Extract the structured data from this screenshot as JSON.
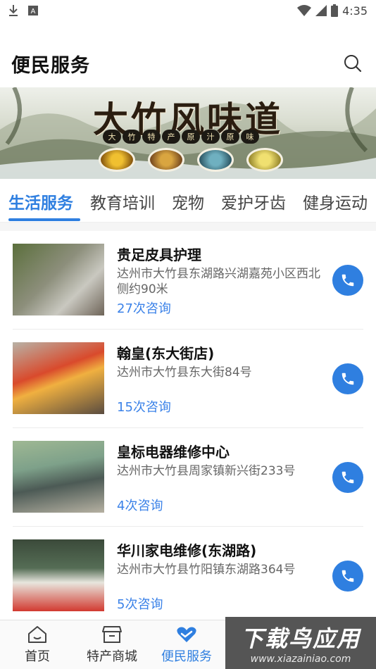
{
  "status": {
    "time": "4:35"
  },
  "header": {
    "title": "便民服务"
  },
  "banner": {
    "title": "大竹风味道",
    "tags": [
      "大",
      "竹",
      "特",
      "产",
      "原",
      "汁",
      "原",
      "味"
    ]
  },
  "tabs": [
    {
      "label": "生活服务",
      "active": true
    },
    {
      "label": "教育培训"
    },
    {
      "label": "宠物"
    },
    {
      "label": "爱护牙齿"
    },
    {
      "label": "健身运动"
    }
  ],
  "listings": [
    {
      "name": "贵足皮具护理",
      "address": "达州市大竹县东湖路兴湖嘉苑小区西北侧约90米",
      "consult": "27次咨询"
    },
    {
      "name": "翰皇(东大街店)",
      "address": "达州市大竹县东大街84号",
      "consult": "15次咨询"
    },
    {
      "name": "皇标电器维修中心",
      "address": "达州市大竹县周家镇新兴街233号",
      "consult": "4次咨询"
    },
    {
      "name": "华川家电维修(东湖路)",
      "address": "达州市大竹县竹阳镇东湖路364号",
      "consult": "5次咨询"
    }
  ],
  "nav": {
    "home": "首页",
    "mall": "特产商城",
    "service": "便民服务"
  },
  "watermark": {
    "main": "下载鸟应用",
    "sub": "www.xiazainiao.com"
  },
  "colors": {
    "accent": "#2f7fe0",
    "consult": "#3b82e8"
  }
}
